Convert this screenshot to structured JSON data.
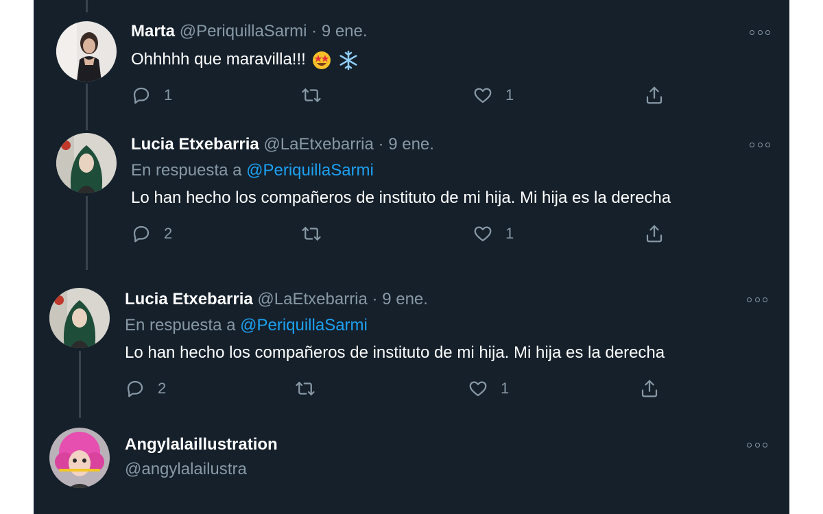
{
  "thread": [
    {
      "name": "Marta",
      "handle": "@PeriquillaSarmi",
      "separator": "·",
      "date": "9 ene.",
      "text": "Ohhhhh que maravilla!!!",
      "emojis": [
        "star-struck-emoji",
        "snowflake-emoji"
      ],
      "replies": "1",
      "retweets": "",
      "likes": "1"
    },
    {
      "name": "Lucia Etxebarria",
      "handle": "@LaEtxebarria",
      "separator": "·",
      "date": "9 ene.",
      "reply_prefix": "En respuesta a",
      "reply_mention": "@PeriquillaSarmi",
      "text": "Lo han hecho los compañeros de instituto de mi hija. Mi hija es la derecha",
      "replies": "2",
      "retweets": "",
      "likes": "1"
    },
    {
      "name": "Lucia Etxebarria",
      "handle": "@LaEtxebarria",
      "separator": "·",
      "date": "9 ene.",
      "reply_prefix": "En respuesta a",
      "reply_mention": "@PeriquillaSarmi",
      "text": "Lo han hecho los compañeros de instituto de mi hija. Mi hija es la derecha",
      "replies": "2",
      "retweets": "",
      "likes": "1"
    }
  ],
  "account": {
    "name": "Angylalaillustration",
    "handle": "@angylalailustra"
  },
  "icons": {
    "reply": "reply-icon",
    "retweet": "retweet-icon",
    "like": "like-icon",
    "share": "share-icon",
    "more": "more-options-icon"
  },
  "colors": {
    "background": "#15202b",
    "text": "#ffffff",
    "secondary": "#8899a6",
    "link": "#1da1f2",
    "thread_line": "#38444d"
  }
}
